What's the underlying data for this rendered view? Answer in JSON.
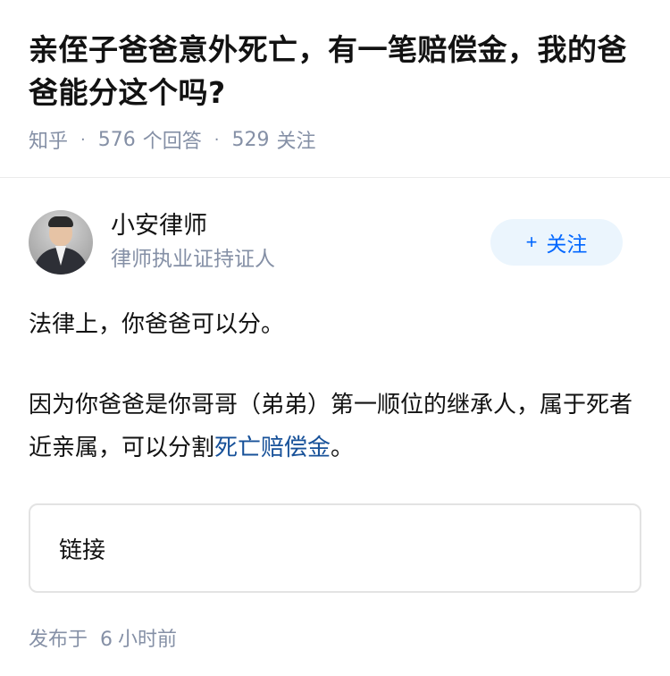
{
  "question": {
    "title": "亲侄子爸爸意外死亡，有一笔赔偿金，我的爸爸能分这个吗?",
    "source": "知乎",
    "answer_count": "576",
    "answer_label": "个回答",
    "follower_count": "529",
    "follower_label": "关注",
    "separator": "·"
  },
  "author": {
    "name": "小安律师",
    "badge": "律师执业证持证人",
    "follow_plus": "+",
    "follow_label": "关注"
  },
  "answer": {
    "para1": "法律上，你爸爸可以分。",
    "para2_text": "因为你爸爸是你哥哥（弟弟）第一顺位的继承人，属于死者近亲属，可以分割",
    "para2_link": "死亡赔偿金",
    "para2_end": "。"
  },
  "link_card": {
    "label": "链接"
  },
  "footer": {
    "prefix": "发布于",
    "time_num": "6",
    "time_unit": "小时前"
  },
  "colors": {
    "link": "#175199",
    "meta": "#8590a6",
    "follow_bg": "#ebf5fd",
    "follow_text": "#0066ff"
  }
}
